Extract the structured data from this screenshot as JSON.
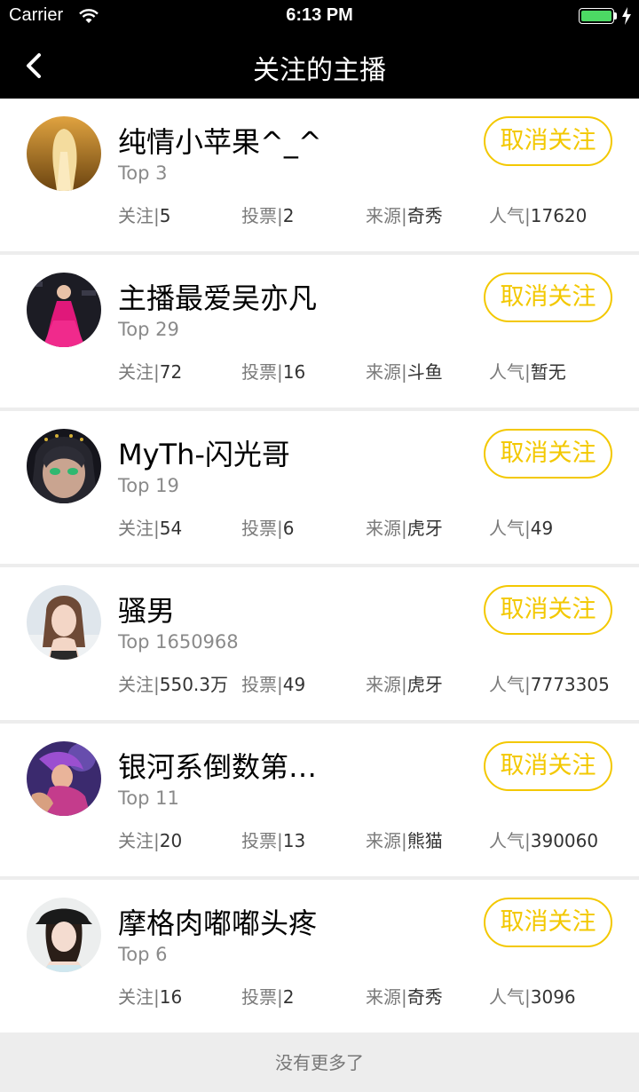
{
  "status_bar": {
    "carrier": "Carrier",
    "time": "6:13 PM"
  },
  "navbar": {
    "title": "关注的主播"
  },
  "labels": {
    "follow": "关注|",
    "votes": "投票|",
    "source": "来源|",
    "popularity": "人气|",
    "unfollow": "取消关注"
  },
  "streamers": [
    {
      "name": "纯情小苹果^_^",
      "rank": "Top 3",
      "follow": "5",
      "votes": "2",
      "source": "奇秀",
      "popularity": "17620"
    },
    {
      "name": "主播最爱吴亦凡",
      "rank": "Top 29",
      "follow": "72",
      "votes": "16",
      "source": "斗鱼",
      "popularity": "暂无"
    },
    {
      "name": "MyTh-闪光哥",
      "rank": "Top 19",
      "follow": "54",
      "votes": "6",
      "source": "虎牙",
      "popularity": "49"
    },
    {
      "name": "骚男",
      "rank": "Top 1650968",
      "follow": "550.3万",
      "votes": "49",
      "source": "虎牙",
      "popularity": "7773305"
    },
    {
      "name": "银河系倒数第…",
      "rank": "Top 11",
      "follow": "20",
      "votes": "13",
      "source": "熊猫",
      "popularity": "390060"
    },
    {
      "name": "摩格肉嘟嘟头疼",
      "rank": "Top 6",
      "follow": "16",
      "votes": "2",
      "source": "奇秀",
      "popularity": "3096"
    }
  ],
  "footer": {
    "text": "没有更多了"
  },
  "colors": {
    "accent": "#f3c800",
    "navbar": "#000000",
    "battery": "#4cd964"
  }
}
